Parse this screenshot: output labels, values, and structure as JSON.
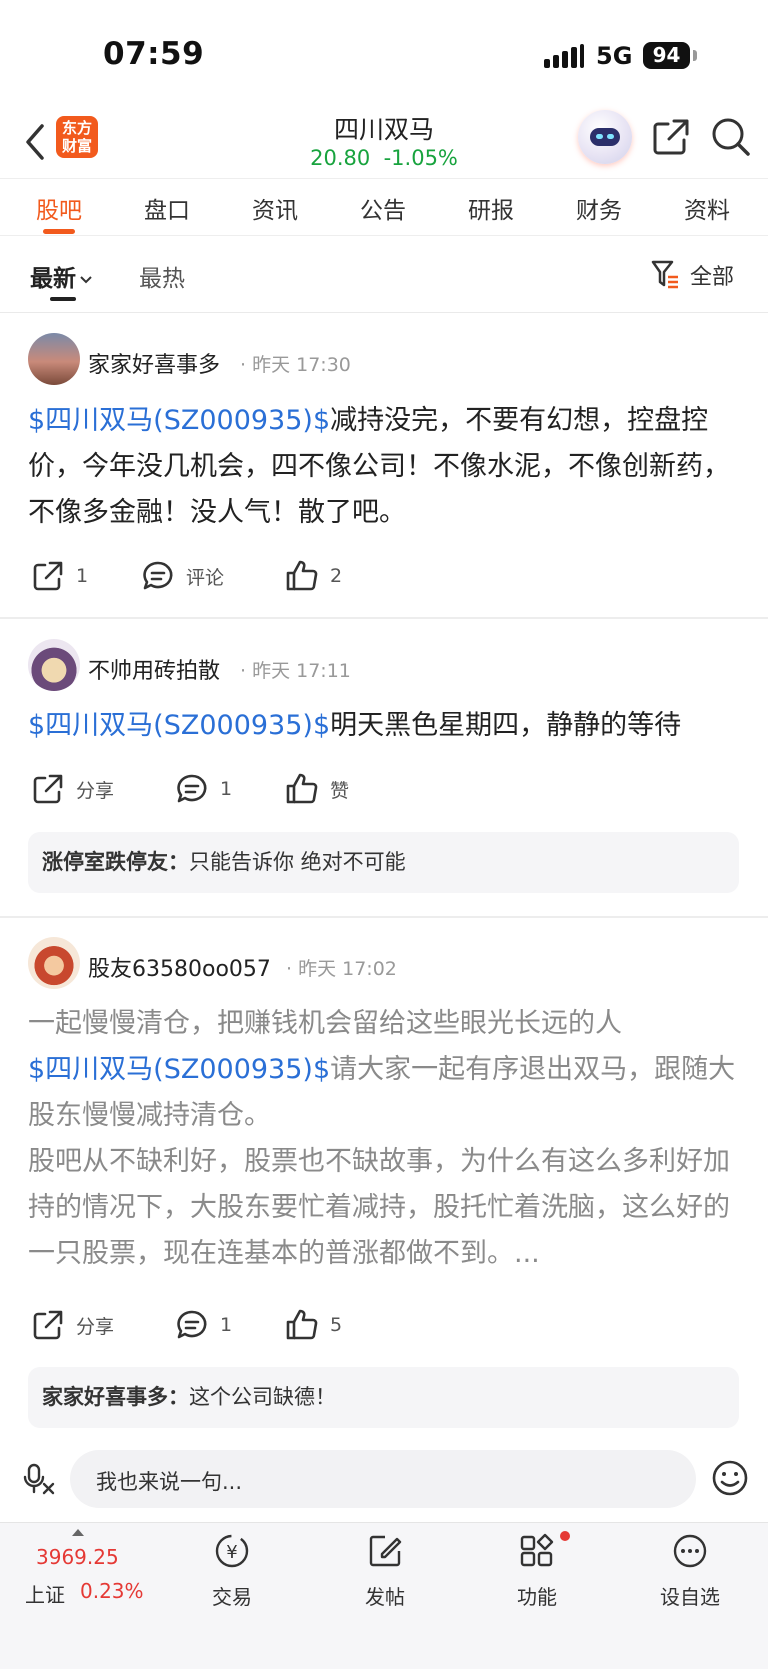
{
  "status_bar": {
    "time": "07:59",
    "network": "5G",
    "battery": "94"
  },
  "header": {
    "logo_line1": "东方",
    "logo_line2": "财富",
    "stock_name": "四川双马",
    "price": "20.80",
    "change": "-1.05%"
  },
  "tabs": [
    "股吧",
    "盘口",
    "资讯",
    "公告",
    "研报",
    "财务",
    "资料"
  ],
  "filter": {
    "latest": "最新",
    "hot": "最热",
    "all": "全部"
  },
  "posts": [
    {
      "author": "家家好喜事多",
      "time": "· 昨天 17:30",
      "tag": "$四川双马(SZ000935)$",
      "text": "减持没完，不要有幻想，控盘控价，今年没几机会，四不像公司！不像水泥，不像创新药，不像多金融！没人气！散了吧。",
      "share": "1",
      "comment": "评论",
      "like": "2"
    },
    {
      "author": "不帅用砖拍散",
      "time": "· 昨天 17:11",
      "tag": "$四川双马(SZ000935)$",
      "text": "明天黑色星期四，静静的等待",
      "share": "分享",
      "comment": "1",
      "like": "赞",
      "reply_author": "涨停室跌停友：",
      "reply_text": "只能告诉你 绝对不可能"
    },
    {
      "author": "股友63580oo057",
      "time": "· 昨天 17:02",
      "title": "一起慢慢清仓，把赚钱机会留给这些眼光长远的人",
      "tag": "$四川双马(SZ000935)$",
      "text": "请大家一起有序退出双马，跟随大股东慢慢减持清仓。",
      "text2": "股吧从不缺利好，股票也不缺故事，为什么有这么多利好加持的情况下，大股东要忙着减持，股托忙着洗脑，这么好的一只股票，现在连基本的普涨都做不到。...",
      "share": "分享",
      "comment": "1",
      "like": "5",
      "reply_author": "家家好喜事多：",
      "reply_text": "这个公司缺德！"
    }
  ],
  "comment_bar": {
    "placeholder": "我也来说一句..."
  },
  "bottom_nav": {
    "index_value": "3969.25",
    "index_name": "上证",
    "index_change": "0.23%",
    "items": [
      "交易",
      "发帖",
      "功能",
      "设自选"
    ]
  },
  "colors": {
    "accent": "#f25a1d",
    "green": "#18a33e",
    "red": "#e53935",
    "link": "#2a6fd6"
  }
}
